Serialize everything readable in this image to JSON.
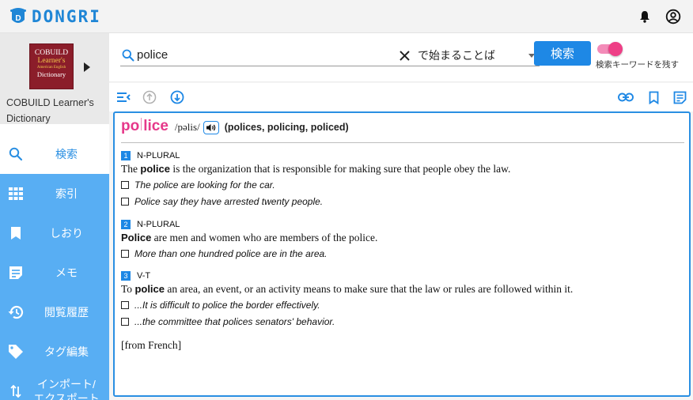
{
  "app": {
    "name": "DONGRI"
  },
  "colors": {
    "brand": "#1f86d6",
    "accent_pink": "#e6388a",
    "nav_blue": "#58aef3",
    "button_blue": "#1e88e5"
  },
  "sidebar": {
    "book": {
      "cover_lines": [
        "COBUILD",
        "Learner's",
        "American English",
        "Dictionary"
      ],
      "title": "COBUILD Learner's Dictionary"
    },
    "items": [
      {
        "label": "検索",
        "icon": "search-icon"
      },
      {
        "label": "索引",
        "icon": "grid-icon"
      },
      {
        "label": "しおり",
        "icon": "bookmark-icon"
      },
      {
        "label": "メモ",
        "icon": "note-icon"
      },
      {
        "label": "閲覧履歴",
        "icon": "history-icon"
      },
      {
        "label": "タグ編集",
        "icon": "tag-icon"
      },
      {
        "label_line1": "インポート/",
        "label_line2": "エクスポート",
        "icon": "import-export-icon"
      }
    ]
  },
  "search": {
    "query": "police",
    "mode": "で始まることば",
    "button": "検索",
    "keep_keyword_label": "検索キーワードを残す",
    "keep_keyword_on": true
  },
  "entry": {
    "headword_part1": "po",
    "headword_part2": "lice",
    "pronunciation": "/pəlis/",
    "forms": "(polices, policing, policed)",
    "senses": [
      {
        "num": "1",
        "gram": "N-PLURAL",
        "def_pre": "The ",
        "def_bold": "police",
        "def_post": " is the organization that is responsible for making sure that people obey the law.",
        "examples": [
          "The police are looking for the car.",
          "Police say they have arrested twenty people."
        ]
      },
      {
        "num": "2",
        "gram": "N-PLURAL",
        "def_pre": "",
        "def_bold": "Police",
        "def_post": " are men and women who are members of the police.",
        "examples": [
          "More than one hundred police are in the area."
        ]
      },
      {
        "num": "3",
        "gram": "V-T",
        "def_pre": "To ",
        "def_bold": "police",
        "def_post": " an area, an event, or an activity means to make sure that the law or rules are followed within it.",
        "examples": [
          "...It is difficult to police the border effectively.",
          "...the committee that polices senators' behavior."
        ]
      }
    ],
    "etymology": "[from French]"
  }
}
